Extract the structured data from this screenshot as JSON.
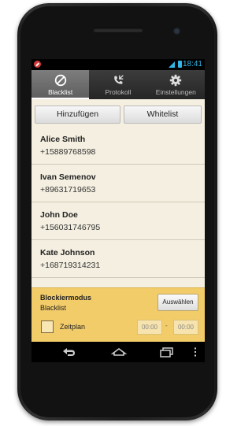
{
  "status_bar": {
    "time": "18:41",
    "accent_color": "#33b5e5",
    "icons": [
      "block-notification-icon",
      "signal-icon",
      "battery-icon"
    ]
  },
  "tabs": [
    {
      "label": "Blacklist",
      "icon": "block-icon",
      "active": true
    },
    {
      "label": "Protokoll",
      "icon": "phone-log-icon",
      "active": false
    },
    {
      "label": "Einstellungen",
      "icon": "gear-icon",
      "active": false
    }
  ],
  "actions": {
    "add_label": "Hinzufügen",
    "whitelist_label": "Whitelist"
  },
  "contacts": [
    {
      "name": "Alice Smith",
      "number": "+15889768598"
    },
    {
      "name": "Ivan Semenov",
      "number": "+89631719653"
    },
    {
      "name": "John Doe",
      "number": "+156031746795"
    },
    {
      "name": "Kate Johnson",
      "number": "+168719314231"
    }
  ],
  "block_mode": {
    "title": "Blockiermodus",
    "value": "Blacklist",
    "select_label": "Auswählen",
    "panel_color": "#f3cc6a"
  },
  "schedule": {
    "label": "Zeitplan",
    "checked": false,
    "start": "00:00",
    "separator": "-",
    "end": "00:00"
  },
  "nav_icons": [
    "back-icon",
    "home-icon",
    "recent-apps-icon",
    "menu-icon"
  ]
}
